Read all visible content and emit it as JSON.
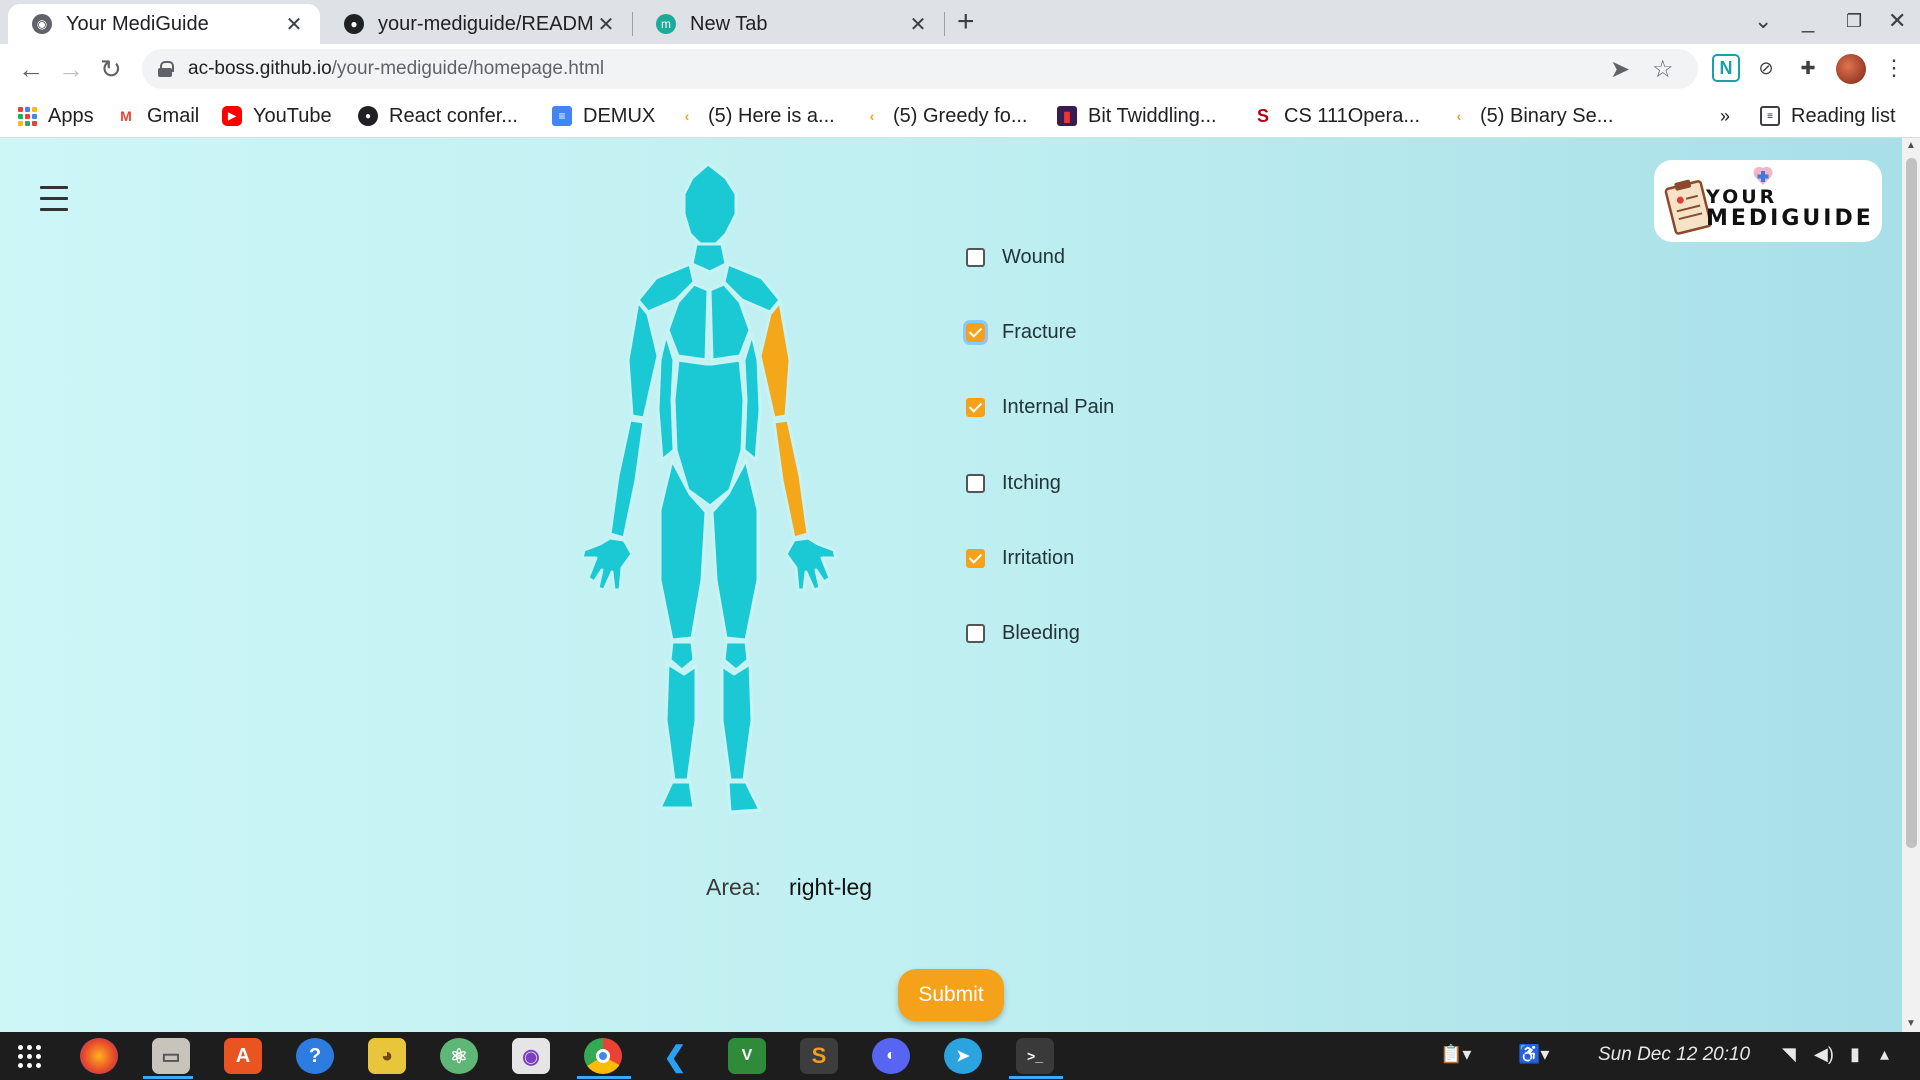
{
  "browser": {
    "tabs": [
      {
        "title": "Your MediGuide",
        "active": true
      },
      {
        "title": "your-mediguide/READM",
        "active": false
      },
      {
        "title": "New Tab",
        "active": false
      }
    ],
    "new_tab": "+",
    "url_host": "ac-boss.github.io",
    "url_path": "/your-mediguide/homepage.html",
    "bookmarks": [
      {
        "label": "Apps",
        "icon": "apps-grid-icon"
      },
      {
        "label": "Gmail",
        "icon": "gmail-icon"
      },
      {
        "label": "YouTube",
        "icon": "youtube-icon"
      },
      {
        "label": "React confer...",
        "icon": "github-icon"
      },
      {
        "label": "DEMUX",
        "icon": "docs-icon"
      },
      {
        "label": "(5) Here is a...",
        "icon": "leetcode-icon"
      },
      {
        "label": "(5) Greedy fo...",
        "icon": "leetcode-icon"
      },
      {
        "label": "Bit Twiddling...",
        "icon": "bookmark-icon"
      },
      {
        "label": "CS 111Opera...",
        "icon": "stanford-icon"
      },
      {
        "label": "(5) Binary Se...",
        "icon": "leetcode-icon"
      }
    ],
    "bookmarks_overflow": "»",
    "reading_list": "Reading list"
  },
  "app": {
    "logo_line1": "YOUR",
    "logo_line2": "MEDIGUIDE",
    "symptoms": [
      {
        "label": "Wound",
        "checked": false
      },
      {
        "label": "Fracture",
        "checked": true
      },
      {
        "label": "Internal Pain",
        "checked": true
      },
      {
        "label": "Itching",
        "checked": false
      },
      {
        "label": "Irritation",
        "checked": true
      },
      {
        "label": "Bleeding",
        "checked": false
      }
    ],
    "area_label": "Area:",
    "area_value": "right-leg",
    "submit_label": "Submit",
    "body_color": "#1bc9d4",
    "highlight_color": "#f5a71a",
    "accent": "#f6a11a"
  },
  "taskbar": {
    "clock": "Sun Dec 12  20:10",
    "apps": [
      "firefox",
      "files",
      "software-center",
      "help",
      "pokemon",
      "atom",
      "screenshot",
      "chrome",
      "vscode",
      "vim",
      "sublime",
      "discord",
      "telegram",
      "terminal"
    ]
  }
}
